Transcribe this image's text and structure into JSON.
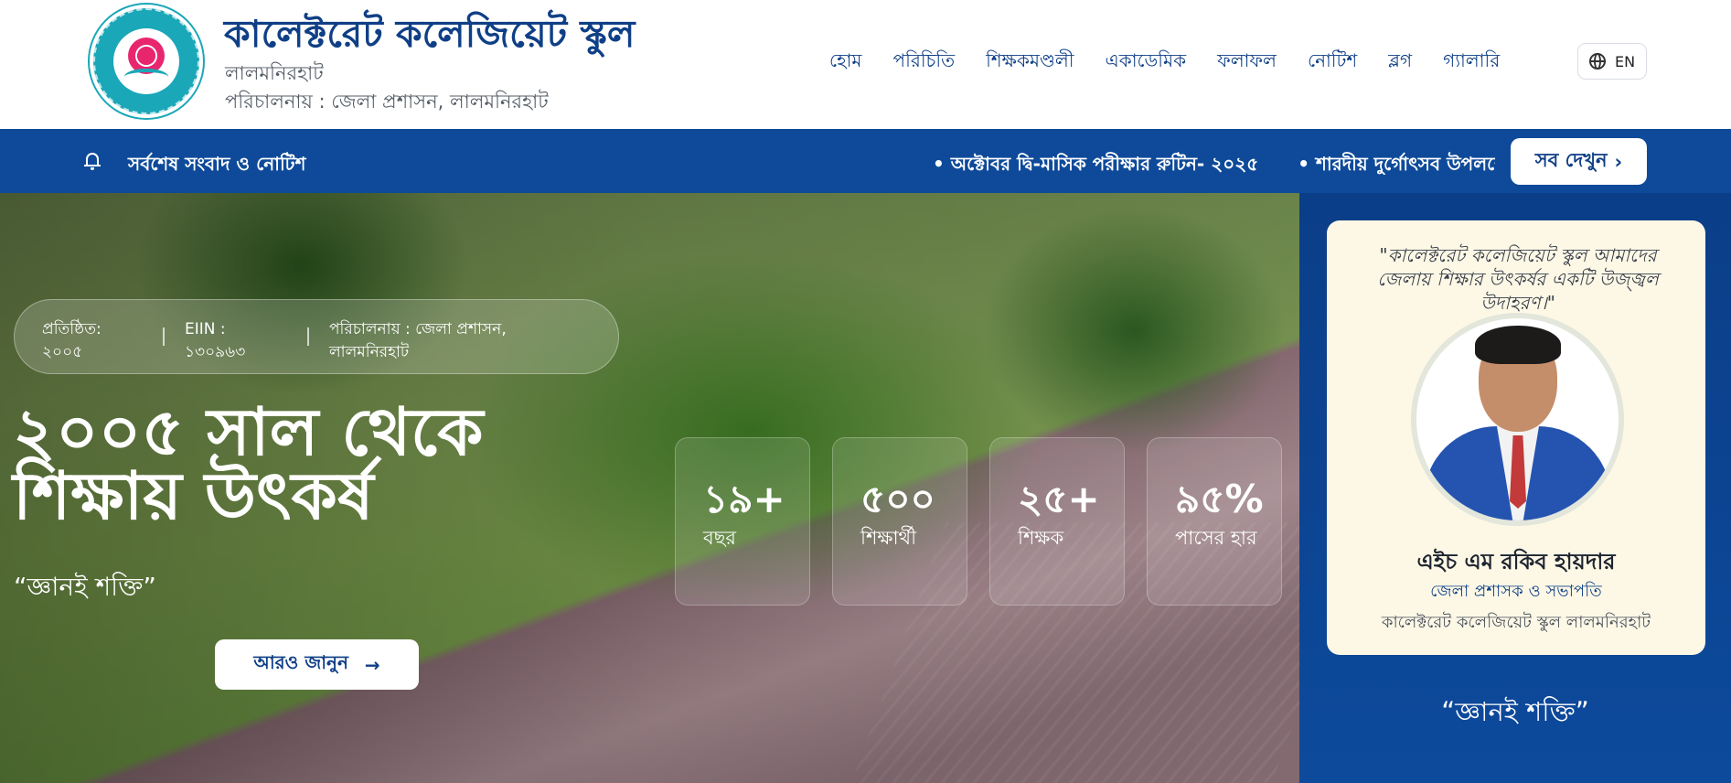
{
  "header": {
    "school_name": "কালেক্টরেট কলেজিয়েট স্কুল",
    "location": "লালমনিরহাট",
    "managed_by": "পরিচালনায় : জেলা প্রশাসন, লালমনিরহাট",
    "logo_icon": "school-logo-icon",
    "nav": [
      "হোম",
      "পরিচিতি",
      "শিক্ষকমণ্ডলী",
      "একাডেমিক",
      "ফলাফল",
      "নোটিশ",
      "ব্লগ",
      "গ্যালারি"
    ],
    "lang_label": "EN"
  },
  "notice": {
    "title": "সর্বশেষ সংবাদ ও নোটিশ",
    "items": [
      "• অক্টোবর দ্বি-মাসিক পরীক্ষার রুটিন- ২০২৫",
      "• শারদীয় দুর্গোৎসব উপলক্ষে"
    ],
    "see_all": "সব দেখুন",
    "see_all_arrow": "›"
  },
  "hero": {
    "established": "প্রতিষ্ঠিত:\n২০০৫",
    "eiin": "EIIN :\n১৩০৯৬৩",
    "management": "পরিচালনায় : জেলা প্রশাসন,\nলালমনিরহাট",
    "title_line1": "২০০৫ সাল থেকে",
    "title_line2": "শিক্ষায় উৎকর্ষ",
    "motto": "“জ্ঞানই শক্তি”",
    "learn_more": "আরও জানুন",
    "learn_more_arrow": "→",
    "stats": [
      {
        "value": "১৯+",
        "label": "বছর"
      },
      {
        "value": "৫০০",
        "label": "শিক্ষার্থী"
      },
      {
        "value": "২৫+",
        "label": "শিক্ষক"
      },
      {
        "value": "৯৫%",
        "label": "পাসের হার"
      }
    ]
  },
  "side": {
    "quote": "\"কালেক্টরেট কলেজিয়েট স্কুল আমাদের জেলায় শিক্ষার উৎকর্ষর একটি উজ্জ্বল উদাহরণ।\"",
    "name": "এইচ এম রকিব হায়দার",
    "role": "জেলা প্রশাসক ও সভাপতি",
    "org": "কালেক্টরেট কলেজিয়েট স্কুল লালমনিরহাট",
    "motto": "“জ্ঞানই শক্তি”"
  },
  "colors": {
    "brand_blue": "#0f3f86",
    "notice_bar": "#0e4a99",
    "logo_teal": "#1aa7b8",
    "card_bg": "#fdf8e6"
  }
}
